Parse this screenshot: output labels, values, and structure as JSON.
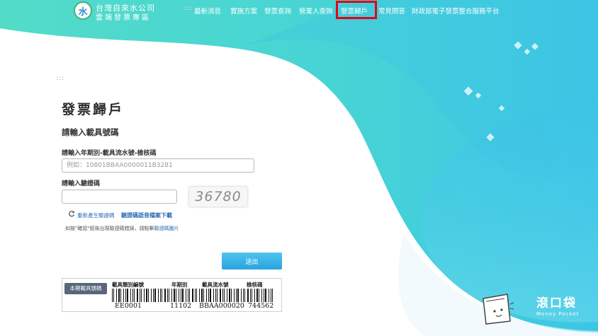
{
  "brand": {
    "line1": "台灣自來水公司",
    "line2": "雲端發票專區"
  },
  "nav": {
    "dots": ":::",
    "items": [
      "最新消息",
      "實施方案",
      "發票查詢",
      "營業人查詢",
      "發票歸戶",
      "常見問答",
      "財政部電子發票整合服務平台"
    ],
    "active": "發票歸戶"
  },
  "page": {
    "side_dots": ":::",
    "title": "發票歸戶",
    "subtitle": "請輸入載具號碼",
    "carrier_label": "請輸入年期別-載具流水號-檢核碼",
    "carrier_placeholder": "例如：10801BBAA0000011B3281",
    "captcha_label": "請輸入驗證碼",
    "captcha_value": "36780",
    "refresh_label": "重新產生驗證碼",
    "audio_label": "驗證碼語音檔案下載",
    "note_prefix": "如按\"確認\"鈕後出現驗證碼錯誤，請點擊",
    "note_link": "驗證碼圖片",
    "submit_label": "送出"
  },
  "carrier_card": {
    "tag": "本期載具號碼",
    "headers": [
      "載具類別編號",
      "年期別",
      "載具流水號",
      "檢核碼"
    ],
    "values": [
      "EE0001",
      "11102",
      "BBAA000020",
      "744562"
    ]
  },
  "watermark": {
    "name": "滾口袋",
    "sub": "Money Pocket"
  },
  "colors": {
    "accent": "#2aa4e0",
    "highlight": "#e60012",
    "teal": "#4fd0c9"
  }
}
